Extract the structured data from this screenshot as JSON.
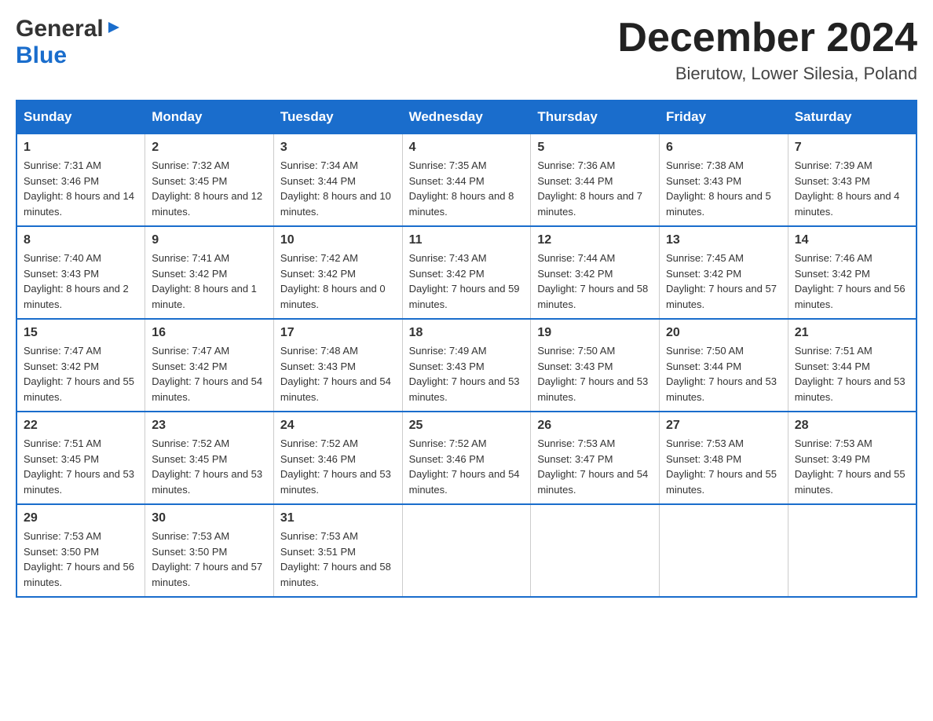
{
  "header": {
    "logo_general": "General",
    "logo_blue": "Blue",
    "month_title": "December 2024",
    "location": "Bierutow, Lower Silesia, Poland"
  },
  "weekdays": [
    "Sunday",
    "Monday",
    "Tuesday",
    "Wednesday",
    "Thursday",
    "Friday",
    "Saturday"
  ],
  "weeks": [
    [
      {
        "day": "1",
        "sunrise": "7:31 AM",
        "sunset": "3:46 PM",
        "daylight": "8 hours and 14 minutes."
      },
      {
        "day": "2",
        "sunrise": "7:32 AM",
        "sunset": "3:45 PM",
        "daylight": "8 hours and 12 minutes."
      },
      {
        "day": "3",
        "sunrise": "7:34 AM",
        "sunset": "3:44 PM",
        "daylight": "8 hours and 10 minutes."
      },
      {
        "day": "4",
        "sunrise": "7:35 AM",
        "sunset": "3:44 PM",
        "daylight": "8 hours and 8 minutes."
      },
      {
        "day": "5",
        "sunrise": "7:36 AM",
        "sunset": "3:44 PM",
        "daylight": "8 hours and 7 minutes."
      },
      {
        "day": "6",
        "sunrise": "7:38 AM",
        "sunset": "3:43 PM",
        "daylight": "8 hours and 5 minutes."
      },
      {
        "day": "7",
        "sunrise": "7:39 AM",
        "sunset": "3:43 PM",
        "daylight": "8 hours and 4 minutes."
      }
    ],
    [
      {
        "day": "8",
        "sunrise": "7:40 AM",
        "sunset": "3:43 PM",
        "daylight": "8 hours and 2 minutes."
      },
      {
        "day": "9",
        "sunrise": "7:41 AM",
        "sunset": "3:42 PM",
        "daylight": "8 hours and 1 minute."
      },
      {
        "day": "10",
        "sunrise": "7:42 AM",
        "sunset": "3:42 PM",
        "daylight": "8 hours and 0 minutes."
      },
      {
        "day": "11",
        "sunrise": "7:43 AM",
        "sunset": "3:42 PM",
        "daylight": "7 hours and 59 minutes."
      },
      {
        "day": "12",
        "sunrise": "7:44 AM",
        "sunset": "3:42 PM",
        "daylight": "7 hours and 58 minutes."
      },
      {
        "day": "13",
        "sunrise": "7:45 AM",
        "sunset": "3:42 PM",
        "daylight": "7 hours and 57 minutes."
      },
      {
        "day": "14",
        "sunrise": "7:46 AM",
        "sunset": "3:42 PM",
        "daylight": "7 hours and 56 minutes."
      }
    ],
    [
      {
        "day": "15",
        "sunrise": "7:47 AM",
        "sunset": "3:42 PM",
        "daylight": "7 hours and 55 minutes."
      },
      {
        "day": "16",
        "sunrise": "7:47 AM",
        "sunset": "3:42 PM",
        "daylight": "7 hours and 54 minutes."
      },
      {
        "day": "17",
        "sunrise": "7:48 AM",
        "sunset": "3:43 PM",
        "daylight": "7 hours and 54 minutes."
      },
      {
        "day": "18",
        "sunrise": "7:49 AM",
        "sunset": "3:43 PM",
        "daylight": "7 hours and 53 minutes."
      },
      {
        "day": "19",
        "sunrise": "7:50 AM",
        "sunset": "3:43 PM",
        "daylight": "7 hours and 53 minutes."
      },
      {
        "day": "20",
        "sunrise": "7:50 AM",
        "sunset": "3:44 PM",
        "daylight": "7 hours and 53 minutes."
      },
      {
        "day": "21",
        "sunrise": "7:51 AM",
        "sunset": "3:44 PM",
        "daylight": "7 hours and 53 minutes."
      }
    ],
    [
      {
        "day": "22",
        "sunrise": "7:51 AM",
        "sunset": "3:45 PM",
        "daylight": "7 hours and 53 minutes."
      },
      {
        "day": "23",
        "sunrise": "7:52 AM",
        "sunset": "3:45 PM",
        "daylight": "7 hours and 53 minutes."
      },
      {
        "day": "24",
        "sunrise": "7:52 AM",
        "sunset": "3:46 PM",
        "daylight": "7 hours and 53 minutes."
      },
      {
        "day": "25",
        "sunrise": "7:52 AM",
        "sunset": "3:46 PM",
        "daylight": "7 hours and 54 minutes."
      },
      {
        "day": "26",
        "sunrise": "7:53 AM",
        "sunset": "3:47 PM",
        "daylight": "7 hours and 54 minutes."
      },
      {
        "day": "27",
        "sunrise": "7:53 AM",
        "sunset": "3:48 PM",
        "daylight": "7 hours and 55 minutes."
      },
      {
        "day": "28",
        "sunrise": "7:53 AM",
        "sunset": "3:49 PM",
        "daylight": "7 hours and 55 minutes."
      }
    ],
    [
      {
        "day": "29",
        "sunrise": "7:53 AM",
        "sunset": "3:50 PM",
        "daylight": "7 hours and 56 minutes."
      },
      {
        "day": "30",
        "sunrise": "7:53 AM",
        "sunset": "3:50 PM",
        "daylight": "7 hours and 57 minutes."
      },
      {
        "day": "31",
        "sunrise": "7:53 AM",
        "sunset": "3:51 PM",
        "daylight": "7 hours and 58 minutes."
      },
      null,
      null,
      null,
      null
    ]
  ],
  "labels": {
    "sunrise": "Sunrise:",
    "sunset": "Sunset:",
    "daylight": "Daylight:"
  }
}
